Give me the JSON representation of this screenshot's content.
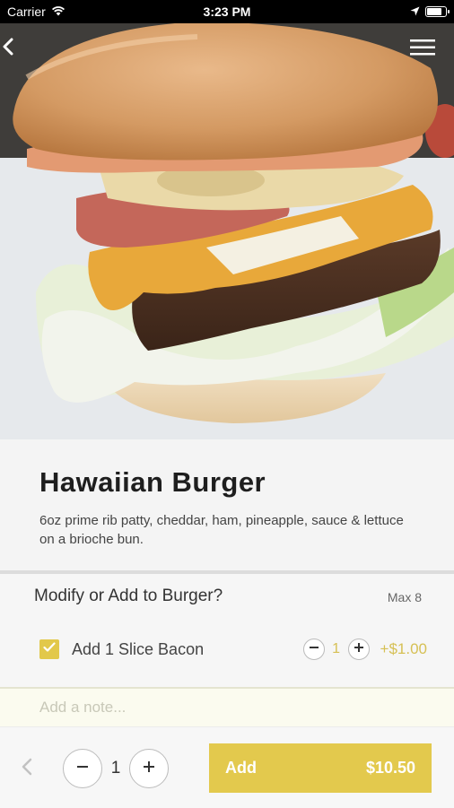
{
  "status_bar": {
    "carrier": "Carrier",
    "time": "3:23 PM",
    "battery_level": 0.9
  },
  "item": {
    "title": "Hawaiian Burger",
    "description": "6oz prime rib patty, cheddar, ham, pineapple, sauce & lettuce on a brioche bun."
  },
  "modifiers": {
    "heading": "Modify or Add to Burger?",
    "max_label": "Max 8",
    "options": [
      {
        "label": "Add 1 Slice Bacon",
        "checked": true,
        "quantity": "1",
        "price": "+$1.00"
      }
    ]
  },
  "note": {
    "placeholder": "Add a note..."
  },
  "footer": {
    "quantity": "1",
    "add_label": "Add",
    "total": "$10.50"
  },
  "colors": {
    "accent": "#e3c94d",
    "accent_text": "#d6c054",
    "background": "#f4f4f4"
  },
  "icons": [
    "wifi-icon",
    "location-arrow-icon",
    "battery-icon",
    "back-chevron-icon",
    "hamburger-menu-icon",
    "check-icon",
    "minus-icon",
    "plus-icon",
    "prev-chevron-icon"
  ]
}
